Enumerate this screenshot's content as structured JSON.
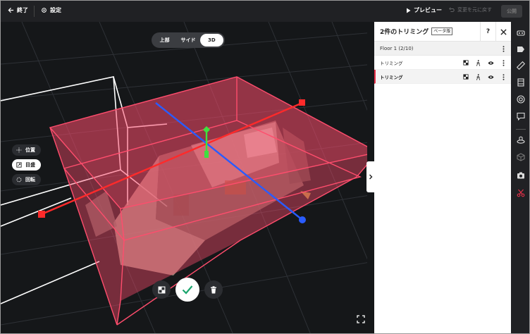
{
  "topbar": {
    "exit_label": "終了",
    "settings_label": "設定",
    "preview_label": "プレビュー",
    "undo_label": "変更を元に戻す",
    "publish_label": "公開"
  },
  "view_toggle": {
    "options": [
      "上部",
      "サイド",
      "3D"
    ],
    "selected": "3D"
  },
  "tools": {
    "position_label": "位置",
    "scale_label": "目盛",
    "rotate_label": "回転",
    "selected": "目盛"
  },
  "panel": {
    "title": "2件のトリミング",
    "beta_label": "ベータ版",
    "help_label": "?",
    "floor_label": "Floor 1 (2/10)",
    "rows": [
      {
        "label": "トリミング",
        "selected": false
      },
      {
        "label": "トリミング",
        "selected": true
      }
    ]
  },
  "right_toolbar": {
    "icons": [
      "vr-headset-icon",
      "tag-icon",
      "ruler-icon",
      "film-icon",
      "target-icon",
      "comment-icon",
      "floor-plan-icon",
      "cube-icon",
      "camera-icon",
      "scissors-icon"
    ],
    "active_icon": "scissors-icon"
  },
  "colors": {
    "accent": "#e8314a",
    "trim_box": "#ff4d6d",
    "axis_x": "#ff2a2a",
    "axis_y": "#2a6cff",
    "axis_z": "#3fe03f",
    "confirm": "#1aa56d"
  }
}
